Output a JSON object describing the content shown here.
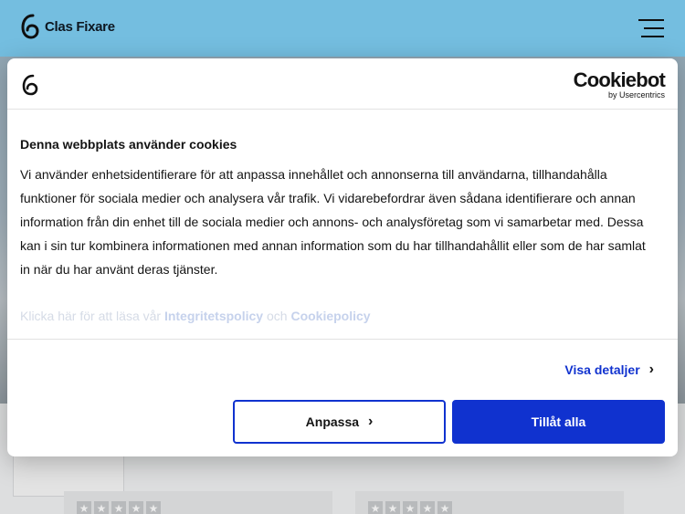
{
  "site": {
    "brand": "Clas Fixare"
  },
  "dialog": {
    "provider_name": "Cookiebot",
    "provider_sub": "by Usercentrics",
    "title": "Denna webbplats använder cookies",
    "body": "Vi använder enhetsidentifierare för att anpassa innehållet och annonserna till användarna, tillhandahålla funktioner för sociala medier och analysera vår trafik. Vi vidarebefordrar även sådana identifierare och annan information från din enhet till de sociala medier och annons- och analysföretag som vi samarbetar med. Dessa kan i sin tur kombinera informationen med annan information som du har tillhandahållit eller som de har samlat in när du har använt deras tjänster.",
    "policy_prefix": "Klicka här för att läsa vår",
    "policy_link_1": "Integritetspolicy",
    "policy_and": "och",
    "policy_link_2": "Cookiepolicy",
    "details_label": "Visa detaljer",
    "customize_label": "Anpassa",
    "allow_label": "Tillåt alla"
  },
  "icons": {
    "menu": "hamburger-icon",
    "chevron": "chevron-right-icon",
    "star": "star-icon"
  },
  "colors": {
    "header_bg": "#7ecff4",
    "accent": "#1032cf"
  }
}
